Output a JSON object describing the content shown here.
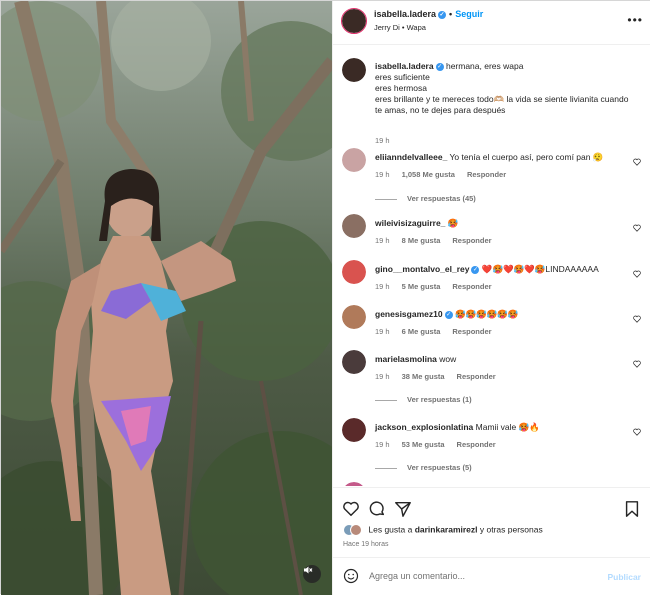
{
  "header": {
    "username": "isabella.ladera",
    "follow_label": "Seguir",
    "subtitle": "Jerry Di • Wapa",
    "more_icon": "more-horizontal-icon"
  },
  "caption": {
    "username": "isabella.ladera",
    "lines": [
      "hermana, eres wapa",
      "eres suficiente",
      "eres hermosa",
      "eres brillante y te mereces todo🫶🏼 la vida se siente livianita cuando te amas, no te dejes para después"
    ],
    "time": "19 h"
  },
  "comments": [
    {
      "username": "eliianndelvalleee_",
      "text": "Yo tenía el cuerpo así, pero comí pan 😮‍💨",
      "time": "19 h",
      "likes": "1,058 Me gusta",
      "reply": "Responder",
      "replies": "Ver respuestas (45)",
      "avatar_color": "#c9a3a3"
    },
    {
      "username": "wileivisizaguirre_",
      "text": "🥵",
      "time": "19 h",
      "likes": "8 Me gusta",
      "reply": "Responder",
      "replies": "",
      "avatar_color": "#8a6f63"
    },
    {
      "username": "gino__montalvo_el_rey",
      "text": "❤️🥵❤️🥵❤️🥵LINDAAAAAA",
      "time": "19 h",
      "likes": "5 Me gusta",
      "reply": "Responder",
      "replies": "",
      "avatar_color": "#d9534f",
      "verified": true
    },
    {
      "username": "genesisgamez10",
      "text": "🥵🥵🥵🥵🥵🥵",
      "time": "19 h",
      "likes": "6 Me gusta",
      "reply": "Responder",
      "replies": "",
      "avatar_color": "#b07a5a",
      "verified": true
    },
    {
      "username": "marielasmolina",
      "text": "wow",
      "time": "19 h",
      "likes": "38 Me gusta",
      "reply": "Responder",
      "replies": "Ver respuestas (1)",
      "avatar_color": "#4a3b3b"
    },
    {
      "username": "jackson_explosionlatina",
      "text": "Mamii vale 🥵🔥",
      "time": "19 h",
      "likes": "53 Me gusta",
      "reply": "Responder",
      "replies": "Ver respuestas (5)",
      "avatar_color": "#5a2a2a"
    }
  ],
  "actions": {
    "likes_text_prefix": "Les gusta a ",
    "likes_user": "darinkaramirezl",
    "likes_text_suffix": " y otras personas",
    "time_ago": "Hace 19 horas"
  },
  "add_comment": {
    "placeholder": "Agrega un comentario...",
    "publish_label": "Publicar"
  },
  "colors": {
    "accent": "#0095f6",
    "verified": "#3897f0",
    "muted": "#737373"
  }
}
